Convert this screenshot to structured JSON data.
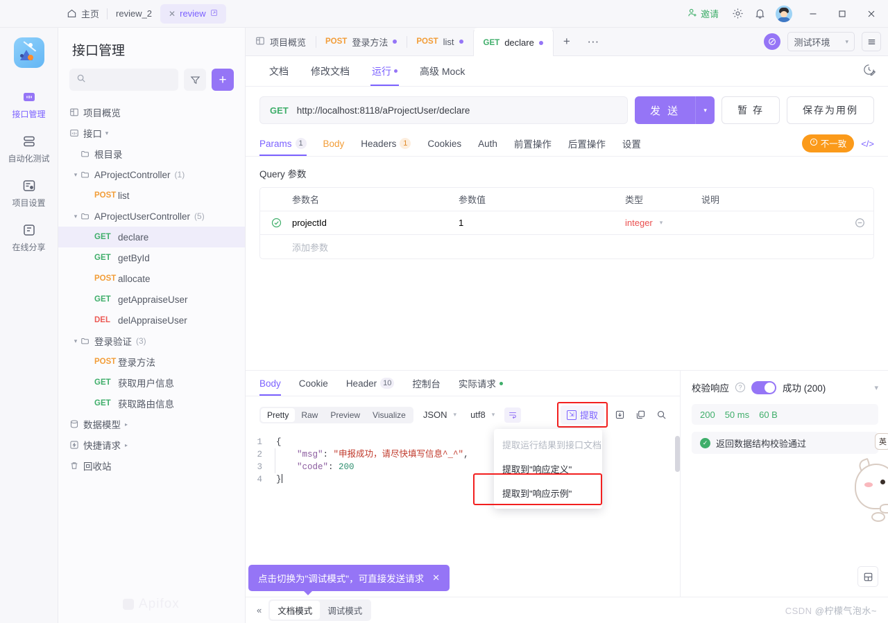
{
  "titlebar": {
    "home_label": "主页",
    "tabs": [
      {
        "label": "review_2",
        "active": false,
        "closable": false,
        "external": false
      },
      {
        "label": "review",
        "active": true,
        "closable": true,
        "external": true
      }
    ],
    "invite_label": "邀请",
    "icons": [
      "invite-user-icon",
      "gear-icon",
      "bell-icon",
      "avatar"
    ],
    "window_controls": [
      "minimize",
      "maximize",
      "close"
    ]
  },
  "rail": {
    "logo_name": "apifox-logo",
    "items": [
      {
        "label": "接口管理",
        "icon": "api-management-icon",
        "active": true
      },
      {
        "label": "自动化测试",
        "icon": "automation-test-icon",
        "active": false
      },
      {
        "label": "项目设置",
        "icon": "project-settings-icon",
        "active": false
      },
      {
        "label": "在线分享",
        "icon": "online-share-icon",
        "active": false
      }
    ]
  },
  "sidebar": {
    "title": "接口管理",
    "search_placeholder": "",
    "filter_icon": "filter-icon",
    "add_label": "+",
    "watermark": "Apifox",
    "tree": [
      {
        "type": "nav",
        "label": "项目概览",
        "icon": "overview-icon",
        "indent": 0
      },
      {
        "type": "nav",
        "label": "接口",
        "icon": "api-icon",
        "indent": 0,
        "caret": "▾"
      },
      {
        "type": "folder",
        "label": "根目录",
        "indent": 1
      },
      {
        "type": "folder",
        "label": "AProjectController",
        "count": "(1)",
        "indent": 1,
        "expanded": true
      },
      {
        "type": "api",
        "method": "POST",
        "label": "list",
        "indent": 2
      },
      {
        "type": "folder",
        "label": "AProjectUserController",
        "count": "(5)",
        "indent": 1,
        "expanded": true
      },
      {
        "type": "api",
        "method": "GET",
        "label": "declare",
        "indent": 2,
        "selected": true
      },
      {
        "type": "api",
        "method": "GET",
        "label": "getById",
        "indent": 2
      },
      {
        "type": "api",
        "method": "POST",
        "label": "allocate",
        "indent": 2
      },
      {
        "type": "api",
        "method": "GET",
        "label": "getAppraiseUser",
        "indent": 2
      },
      {
        "type": "api",
        "method": "DEL",
        "label": "delAppraiseUser",
        "indent": 2
      },
      {
        "type": "folder",
        "label": "登录验证",
        "count": "(3)",
        "indent": 1,
        "expanded": true
      },
      {
        "type": "api",
        "method": "POST",
        "label": "登录方法",
        "indent": 2
      },
      {
        "type": "api",
        "method": "GET",
        "label": "获取用户信息",
        "indent": 2
      },
      {
        "type": "api",
        "method": "GET",
        "label": "获取路由信息",
        "indent": 2
      },
      {
        "type": "nav",
        "label": "数据模型",
        "icon": "data-model-icon",
        "indent": 0,
        "arrow": "▸"
      },
      {
        "type": "nav",
        "label": "快捷请求",
        "icon": "quick-request-icon",
        "indent": 0,
        "arrow": "▸"
      },
      {
        "type": "nav",
        "label": "回收站",
        "icon": "trash-icon",
        "indent": 0
      }
    ]
  },
  "doctabs": {
    "overview_label": "项目概览",
    "tabs": [
      {
        "method": "POST",
        "label": "登录方法",
        "dirty": true,
        "active": false
      },
      {
        "method": "POST",
        "label": "list",
        "dirty": true,
        "active": false
      },
      {
        "method": "GET",
        "label": "declare",
        "dirty": true,
        "active": true
      }
    ],
    "add_label": "+",
    "more_label": "···",
    "refresh_icon": "refresh-icon",
    "environment": "测试环境",
    "menu_icon": "hamburger-icon"
  },
  "modebar": {
    "tabs": [
      {
        "label": "文档",
        "active": false
      },
      {
        "label": "修改文档",
        "active": false
      },
      {
        "label": "运行",
        "active": true,
        "dirty": true
      },
      {
        "label": "高级 Mock",
        "active": false
      }
    ],
    "history_icon": "history-edit-icon"
  },
  "request": {
    "method": "GET",
    "url": "http://localhost:8118/aProjectUser/declare",
    "send_label": "发 送",
    "save_label": "暂 存",
    "save_case_label": "保存为用例"
  },
  "param_tabs": {
    "tabs": [
      {
        "label": "Params",
        "badge": "1",
        "active": true
      },
      {
        "label": "Body",
        "amber": true
      },
      {
        "label": "Headers",
        "badge": "1",
        "badge_orange": true
      },
      {
        "label": "Cookies"
      },
      {
        "label": "Auth"
      },
      {
        "label": "前置操作"
      },
      {
        "label": "后置操作"
      },
      {
        "label": "设置"
      }
    ],
    "warn_label": "不一致",
    "code_icon": "code-brackets-icon"
  },
  "query": {
    "section_label": "Query 参数",
    "headers": [
      "参数名",
      "参数值",
      "类型",
      "说明"
    ],
    "rows": [
      {
        "enabled": true,
        "name": "projectId",
        "value": "1",
        "type": "integer",
        "desc": ""
      }
    ],
    "add_row_placeholder": "添加参数"
  },
  "response": {
    "tabs": [
      {
        "label": "Body",
        "active": true
      },
      {
        "label": "Cookie"
      },
      {
        "label": "Header",
        "badge": "10"
      },
      {
        "label": "控制台"
      },
      {
        "label": "实际请求",
        "dot": true
      }
    ],
    "view_modes": [
      "Pretty",
      "Raw",
      "Preview",
      "Visualize"
    ],
    "view_mode_active": "Pretty",
    "format": "JSON",
    "encoding": "utf8",
    "wrap_icon": "wrap-lines-icon",
    "extract_label": "提取",
    "toolbar_icons": [
      "download-icon",
      "copy-icon",
      "search-icon"
    ],
    "code_lines": [
      {
        "no": "1",
        "segments": [
          {
            "t": "{",
            "c": ""
          }
        ]
      },
      {
        "no": "2",
        "indent": true,
        "segments": [
          {
            "t": "    ",
            "c": ""
          },
          {
            "t": "\"msg\"",
            "c": "k"
          },
          {
            "t": ": ",
            "c": ""
          },
          {
            "t": "\"申报成功，请尽快填写信息^_^\"",
            "c": "s"
          },
          {
            "t": ",",
            "c": ""
          }
        ]
      },
      {
        "no": "3",
        "indent": true,
        "segments": [
          {
            "t": "    ",
            "c": ""
          },
          {
            "t": "\"code\"",
            "c": "k"
          },
          {
            "t": ": ",
            "c": ""
          },
          {
            "t": "200",
            "c": "n"
          }
        ]
      },
      {
        "no": "4",
        "segments": [
          {
            "t": "}",
            "c": ""
          }
        ]
      }
    ]
  },
  "extract_menu": {
    "items": [
      {
        "label": "提取运行结果到接口文档",
        "disabled": true
      },
      {
        "label": "提取到\"响应定义\"",
        "disabled": false
      },
      {
        "label": "提取到\"响应示例\"",
        "disabled": false,
        "highlighted": true
      }
    ]
  },
  "validate_panel": {
    "label": "校验响应",
    "help_icon": "question-icon",
    "toggle_on": true,
    "status": "成功 (200)",
    "collapse_icon": "chevron-down-icon",
    "meta": [
      "200",
      "50 ms",
      "60 B"
    ],
    "pass_message": "返回数据结构校验通过",
    "save_icon": "save-icon"
  },
  "toast": {
    "message": "点击切换为\"调试模式\"，可直接发送请求",
    "close_label": "✕"
  },
  "footer": {
    "collapse_icon": "collapse-left-icon",
    "modes": [
      {
        "label": "文档模式",
        "active": true
      },
      {
        "label": "调试模式",
        "active": false
      }
    ],
    "credit": "@柠檬气泡水~",
    "watermark": "CSDN"
  },
  "sticker": {
    "name": "cat-sticker",
    "bubble_text": "英"
  },
  "colors": {
    "accent": "#9575f6",
    "get": "#3fae6a",
    "post": "#f29d38",
    "del": "#ec5b56",
    "warn": "#fb9a1a",
    "type": "#ea4f4f",
    "highlight_box": "#f21f1f"
  }
}
